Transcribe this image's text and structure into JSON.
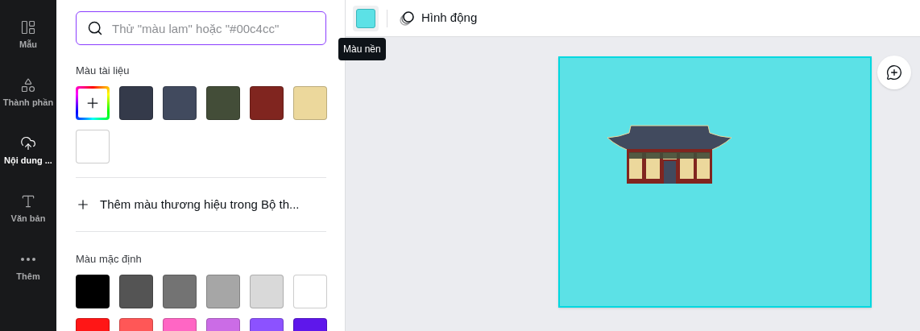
{
  "sidebar": {
    "items": [
      {
        "label": "Mẫu",
        "selected": false
      },
      {
        "label": "Thành phần",
        "selected": false
      },
      {
        "label": "Nội dung ...",
        "selected": true
      },
      {
        "label": "Văn bản",
        "selected": false
      },
      {
        "label": "Thêm",
        "selected": false
      }
    ]
  },
  "color_panel": {
    "search": {
      "placeholder": "Thử \"màu lam\" hoặc \"#00c4cc\""
    },
    "document_colors": {
      "title": "Màu tài liệu",
      "swatches": [
        {
          "kind": "add"
        },
        {
          "kind": "color",
          "color": "#343a4a"
        },
        {
          "kind": "color",
          "color": "#414a5e"
        },
        {
          "kind": "color",
          "color": "#434d38"
        },
        {
          "kind": "color",
          "color": "#80251f"
        },
        {
          "kind": "color",
          "color": "#ecd89c"
        },
        {
          "kind": "color",
          "color": "#ffffff"
        }
      ]
    },
    "brand_link": "Thêm màu thương hiệu trong Bộ th...",
    "default_colors": {
      "title": "Màu mặc định",
      "swatches": [
        {
          "color": "#000000"
        },
        {
          "color": "#545454"
        },
        {
          "color": "#737373"
        },
        {
          "color": "#a6a6a6"
        },
        {
          "color": "#d9d9d9"
        },
        {
          "color": "#ffffff"
        },
        {
          "color": "#ff1616"
        },
        {
          "color": "#ff5757"
        },
        {
          "color": "#ff66c4"
        },
        {
          "color": "#cb6ce6"
        },
        {
          "color": "#8c52ff"
        },
        {
          "color": "#5e17eb"
        }
      ]
    }
  },
  "toolbar": {
    "tooltip": "Màu nền",
    "animate_label": "Hình động"
  }
}
